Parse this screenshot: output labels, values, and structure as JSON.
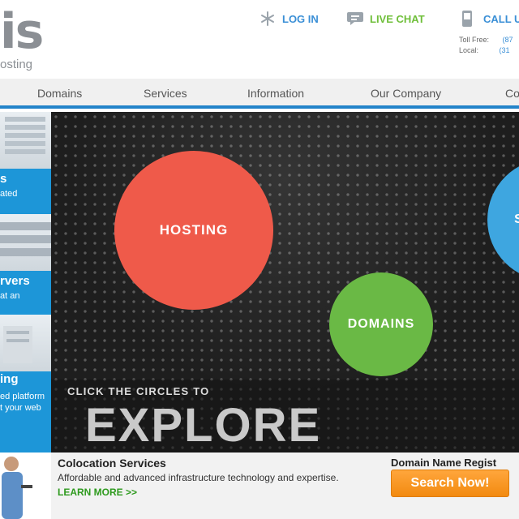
{
  "header": {
    "logo_text": "is",
    "logo_subtext": "osting",
    "login_label": "LOG IN",
    "chat_label": "LIVE CHAT",
    "call_label": "CALL US",
    "contact": {
      "tollfree_label": "Toll Free:",
      "tollfree_value": "(87",
      "local_label": "Local:",
      "local_value": "(31"
    }
  },
  "nav": {
    "items": [
      "Domains",
      "Services",
      "Information",
      "Our Company",
      "Co"
    ]
  },
  "rail": {
    "block1": {
      "title": "s",
      "text": "ated"
    },
    "block2": {
      "title": "rvers",
      "text": "at an"
    },
    "block3": {
      "title": "ing",
      "text_line1": "ed platform",
      "text_line2": "t your web"
    }
  },
  "hero": {
    "circles": {
      "hosting": "HOSTING",
      "domains": "DOMAINS",
      "third": "S"
    },
    "click_text": "CLICK THE CIRCLES TO",
    "explore_text": "EXPLORE"
  },
  "bottom": {
    "colocation_title": "Colocation Services",
    "colocation_desc": "Affordable and advanced infrastructure technology and expertise.",
    "learn_more": "LEARN MORE >>",
    "domain_title": "Domain Name Regist",
    "search_button": "Search Now!"
  },
  "colors": {
    "brand_blue": "#2283c9",
    "hosting_red": "#ef5a4a",
    "domains_green": "#6ab945",
    "services_blue": "#3ea6e0",
    "search_orange": "#f28a10"
  }
}
